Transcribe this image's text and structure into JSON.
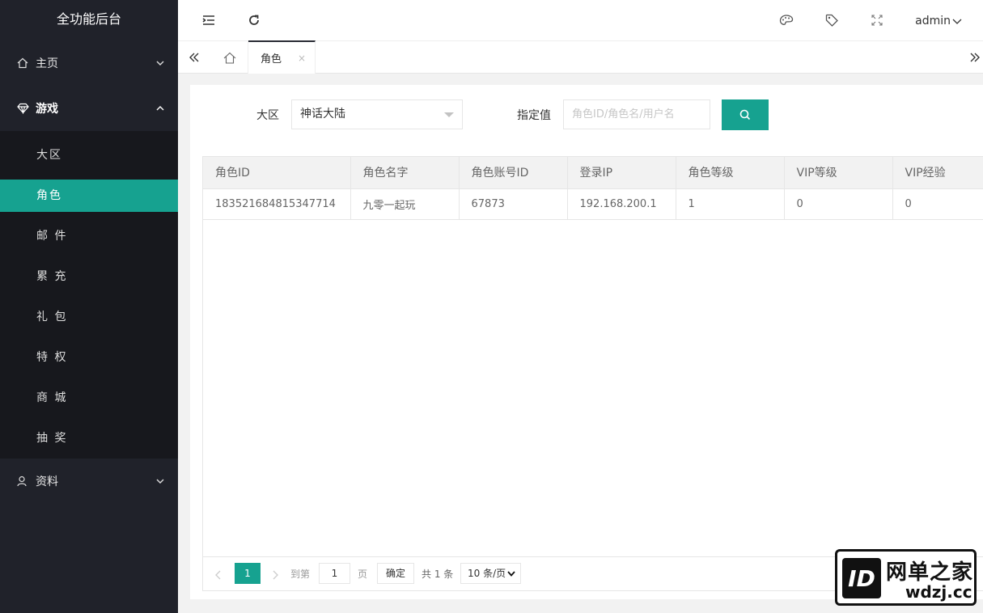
{
  "app": {
    "title": "全功能后台"
  },
  "sidebar": {
    "menus": [
      {
        "label": "主页",
        "icon": "home-icon"
      },
      {
        "label": "游戏",
        "icon": "diamond-icon"
      },
      {
        "label": "资料",
        "icon": "user-icon"
      }
    ],
    "game_items": [
      {
        "label": "大区"
      },
      {
        "label": "角色"
      },
      {
        "label": "邮 件"
      },
      {
        "label": "累 充"
      },
      {
        "label": "礼 包"
      },
      {
        "label": "特 权"
      },
      {
        "label": "商 城"
      },
      {
        "label": "抽 奖"
      }
    ]
  },
  "header": {
    "user": "admin"
  },
  "tabs": {
    "active": "角色",
    "close": "×"
  },
  "filters": {
    "zone_label": "大区",
    "zone_value": "神话大陆",
    "value_label": "指定值",
    "value_placeholder": "角色ID/角色名/用户名"
  },
  "table": {
    "columns": [
      "角色ID",
      "角色名字",
      "角色账号ID",
      "登录IP",
      "角色等级",
      "VIP等级",
      "VIP经验"
    ],
    "rows": [
      [
        "183521684815347714",
        "九零一起玩",
        "67873",
        "192.168.200.1",
        "1",
        "0",
        "0"
      ]
    ]
  },
  "pager": {
    "current": "1",
    "goto_label": "到第",
    "goto_value": "1",
    "page_unit": "页",
    "confirm": "确定",
    "total": "共 1 条",
    "page_size": "10 条/页"
  },
  "brand": {
    "title": "网单之家",
    "domain": "wdzj.cc",
    "mark": "ID"
  },
  "colors": {
    "accent": "#16a290",
    "sidebar_bg": "#20222a"
  }
}
